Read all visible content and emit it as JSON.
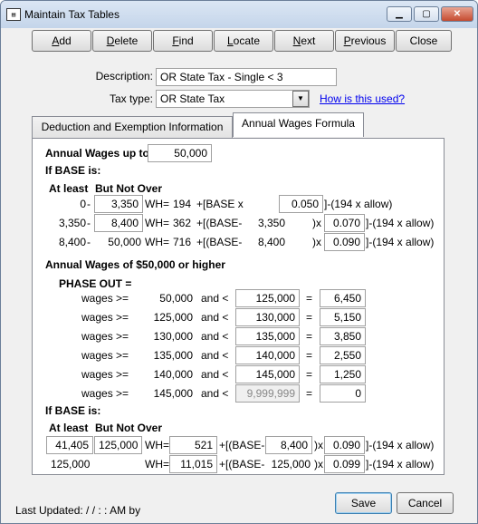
{
  "window": {
    "title": "Maintain Tax Tables"
  },
  "toolbar": {
    "add": {
      "pre": "",
      "acc": "A",
      "post": "dd"
    },
    "delete": {
      "pre": "",
      "acc": "D",
      "post": "elete"
    },
    "find": {
      "pre": "",
      "acc": "F",
      "post": "ind"
    },
    "locate": {
      "pre": "",
      "acc": "L",
      "post": "ocate"
    },
    "next": {
      "pre": "",
      "acc": "N",
      "post": "ext"
    },
    "previous": {
      "pre": "",
      "acc": "P",
      "post": "revious"
    },
    "close_label": "Close"
  },
  "form": {
    "description_label": "Description:",
    "description_value": "OR State Tax - Single < 3",
    "taxtype_label": "Tax type:",
    "taxtype_value": "OR State Tax",
    "help_link": "How is this used?"
  },
  "tabs": {
    "deduction": "Deduction and Exemption Information",
    "wages": "Annual Wages Formula"
  },
  "formula": {
    "annual_wages_label": "Annual Wages up to",
    "annual_wages_value": "50,000",
    "if_base_label": "If BASE is:",
    "at_least_label": "At least",
    "but_not_over_label": "But Not Over",
    "rows": [
      {
        "at_least": "0",
        "dash": "-",
        "not_over": "3,350",
        "wh": "WH=",
        "amount": "194",
        "op": "+[BASE x",
        "rate": "0.050",
        "tail": "]-(194 x allow)"
      },
      {
        "at_least": "3,350",
        "dash": "-",
        "not_over": "8,400",
        "wh": "WH=",
        "amount": "362",
        "op": "+[(BASE-",
        "sub": "3,350",
        "x": ")x",
        "rate": "0.070",
        "tail": "]-(194 x allow)"
      },
      {
        "at_least": "8,400",
        "dash": "-",
        "not_over": "50,000",
        "wh": "WH=",
        "amount": "716",
        "op": "+[(BASE-",
        "sub": "8,400",
        "x": ")x",
        "rate": "0.090",
        "tail": "]-(194 x allow)"
      }
    ],
    "high_label": "Annual Wages of $50,000 or higher",
    "phase_out_label": "PHASE OUT =",
    "phase_rows": [
      {
        "wages": "wages >=",
        "from": "50,000",
        "and": "and <",
        "to": "125,000",
        "eq": "=",
        "value": "6,450"
      },
      {
        "wages": "wages >=",
        "from": "125,000",
        "and": "and <",
        "to": "130,000",
        "eq": "=",
        "value": "5,150"
      },
      {
        "wages": "wages >=",
        "from": "130,000",
        "and": "and <",
        "to": "135,000",
        "eq": "=",
        "value": "3,850"
      },
      {
        "wages": "wages >=",
        "from": "135,000",
        "and": "and <",
        "to": "140,000",
        "eq": "=",
        "value": "2,550"
      },
      {
        "wages": "wages >=",
        "from": "140,000",
        "and": "and <",
        "to": "145,000",
        "eq": "=",
        "value": "1,250"
      },
      {
        "wages": "wages >=",
        "from": "145,000",
        "and": "and <",
        "to": "9,999,999",
        "eq": "=",
        "value": "0"
      }
    ],
    "if_base_label2": "If BASE is:",
    "at_least_label2": "At least",
    "but_not_over_label2": "But Not Over",
    "high_rows": [
      {
        "at_least": "41,405",
        "not_over": "125,000",
        "wh": "WH=",
        "amount": "521",
        "op": "+[(BASE-",
        "sub": "8,400",
        "x": ")x",
        "rate": "0.090",
        "tail": "]-(194 x allow)"
      },
      {
        "at_least": "125,000",
        "wh": "WH=",
        "amount": "11,015",
        "op": "+[(BASE-",
        "sub": "125,000",
        "x": ")x",
        "rate": "0.099",
        "tail": "]-(194 x allow)"
      }
    ]
  },
  "footer": {
    "last_updated": "Last Updated:  / /      :  :  AM by",
    "save_label": "Save",
    "cancel_label": "Cancel"
  }
}
